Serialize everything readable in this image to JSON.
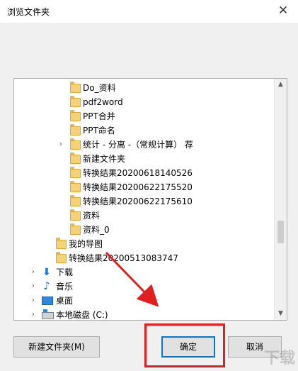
{
  "dialog": {
    "title": "浏览文件夹",
    "close_glyph": "✕"
  },
  "tree": {
    "items": [
      {
        "label": "Do_资料",
        "icon": "folder-icon",
        "chevron": ""
      },
      {
        "label": "pdf2word",
        "icon": "folder-icon",
        "chevron": ""
      },
      {
        "label": "PPT合并",
        "icon": "folder-icon",
        "chevron": ""
      },
      {
        "label": "PPT命名",
        "icon": "folder-icon",
        "chevron": ""
      },
      {
        "label": "统计 - 分离 -（常规计算） 荐",
        "icon": "folder-icon",
        "chevron": "›"
      },
      {
        "label": "新建文件夹",
        "icon": "folder-icon",
        "chevron": ""
      },
      {
        "label": "转换结果20200618140526",
        "icon": "folder-icon",
        "chevron": ""
      },
      {
        "label": "转换结果20200622175520",
        "icon": "folder-icon",
        "chevron": ""
      },
      {
        "label": "转换结果20200622175610",
        "icon": "folder-icon",
        "chevron": ""
      },
      {
        "label": "资料",
        "icon": "folder-icon",
        "chevron": ""
      },
      {
        "label": "资料_0",
        "icon": "folder-icon",
        "chevron": ""
      },
      {
        "label": "我的导图",
        "icon": "folder-icon",
        "chevron": ""
      },
      {
        "label": "转换结果20200513083747",
        "icon": "folder-icon",
        "chevron": ""
      },
      {
        "label": "下载",
        "icon": "download-icon",
        "chevron": "›"
      },
      {
        "label": "音乐",
        "icon": "music-icon",
        "chevron": "›"
      },
      {
        "label": "桌面",
        "icon": "desktop-icon",
        "chevron": "›"
      },
      {
        "label": "本地磁盘 (C:)",
        "icon": "disk-icon",
        "chevron": "›"
      }
    ]
  },
  "buttons": {
    "new_folder": "新建文件夹(M)",
    "ok": "确定",
    "cancel": "取消"
  },
  "watermark": "下载"
}
